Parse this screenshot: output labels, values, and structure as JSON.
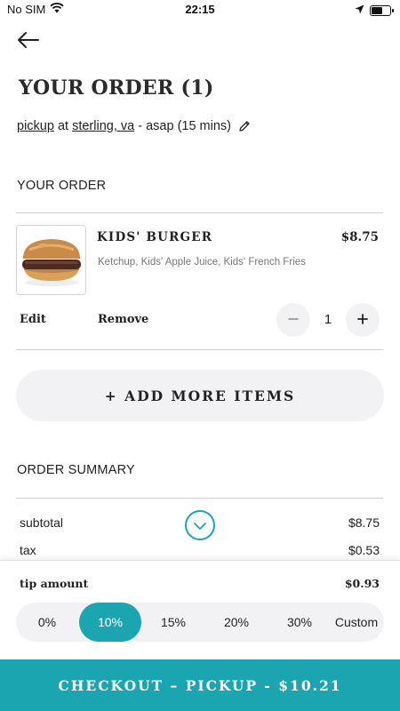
{
  "status_bar": {
    "carrier": "No SIM",
    "time": "22:15"
  },
  "page": {
    "title": "YOUR ORDER (1)"
  },
  "order_info": {
    "mode": "pickup",
    "at": "at",
    "location": "sterling, va",
    "timing": "- asap (15 mins)"
  },
  "cart": {
    "heading": "YOUR ORDER",
    "items": [
      {
        "name": "KIDS' BURGER",
        "price": "$8.75",
        "description": "Ketchup, Kids' Apple Juice, Kids' French Fries",
        "edit_label": "Edit",
        "remove_label": "Remove",
        "quantity": "1"
      }
    ],
    "add_more_label": "+ ADD MORE ITEMS"
  },
  "summary": {
    "heading": "ORDER SUMMARY",
    "subtotal_label": "subtotal",
    "subtotal_value": "$8.75",
    "tax_label": "tax",
    "tax_value": "$0.53"
  },
  "tip": {
    "label": "tip amount",
    "amount": "$0.93",
    "options": [
      "0%",
      "10%",
      "15%",
      "20%",
      "30%",
      "Custom"
    ],
    "selected": "10%"
  },
  "checkout": {
    "label": "CHECKOUT – PICKUP - $10.21"
  },
  "colors": {
    "accent": "#1aa5b0",
    "pill_bg": "#f2f2f4"
  },
  "icons": {
    "back": "arrow-left-icon",
    "edit_order": "pencil-icon",
    "minus": "minus-icon",
    "plus": "plus-icon",
    "expand": "chevron-down-icon"
  }
}
